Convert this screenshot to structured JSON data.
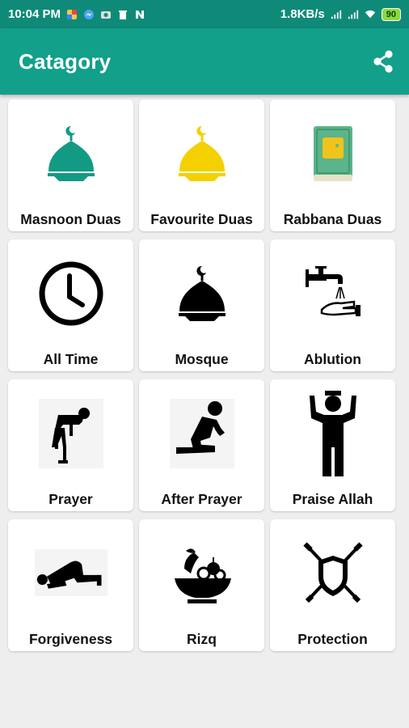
{
  "status_bar": {
    "time": "10:04 PM",
    "net_speed": "1.8KB/s",
    "battery": "90"
  },
  "app_bar": {
    "title": "Catagory",
    "share_icon": "share-icon"
  },
  "colors": {
    "status_bar": "#0f8a78",
    "app_bar": "#12a08b",
    "mosque_teal": "#139a85",
    "mosque_yellow": "#f5d000"
  },
  "categories": [
    {
      "label": "Masnoon Duas",
      "icon": "mosque-teal-icon"
    },
    {
      "label": "Favourite Duas",
      "icon": "mosque-yellow-icon"
    },
    {
      "label": "Rabbana Duas",
      "icon": "quran-book-icon"
    },
    {
      "label": "All Time",
      "icon": "clock-icon"
    },
    {
      "label": "Mosque",
      "icon": "mosque-black-icon"
    },
    {
      "label": "Ablution",
      "icon": "ablution-tap-icon"
    },
    {
      "label": "Prayer",
      "icon": "bowing-prayer-icon"
    },
    {
      "label": "After Prayer",
      "icon": "kneeling-prayer-icon"
    },
    {
      "label": "Praise Allah",
      "icon": "raised-hands-icon"
    },
    {
      "label": "Forgiveness",
      "icon": "prostration-icon"
    },
    {
      "label": "Rizq",
      "icon": "fruit-bowl-icon"
    },
    {
      "label": "Protection",
      "icon": "shield-swords-icon"
    }
  ]
}
